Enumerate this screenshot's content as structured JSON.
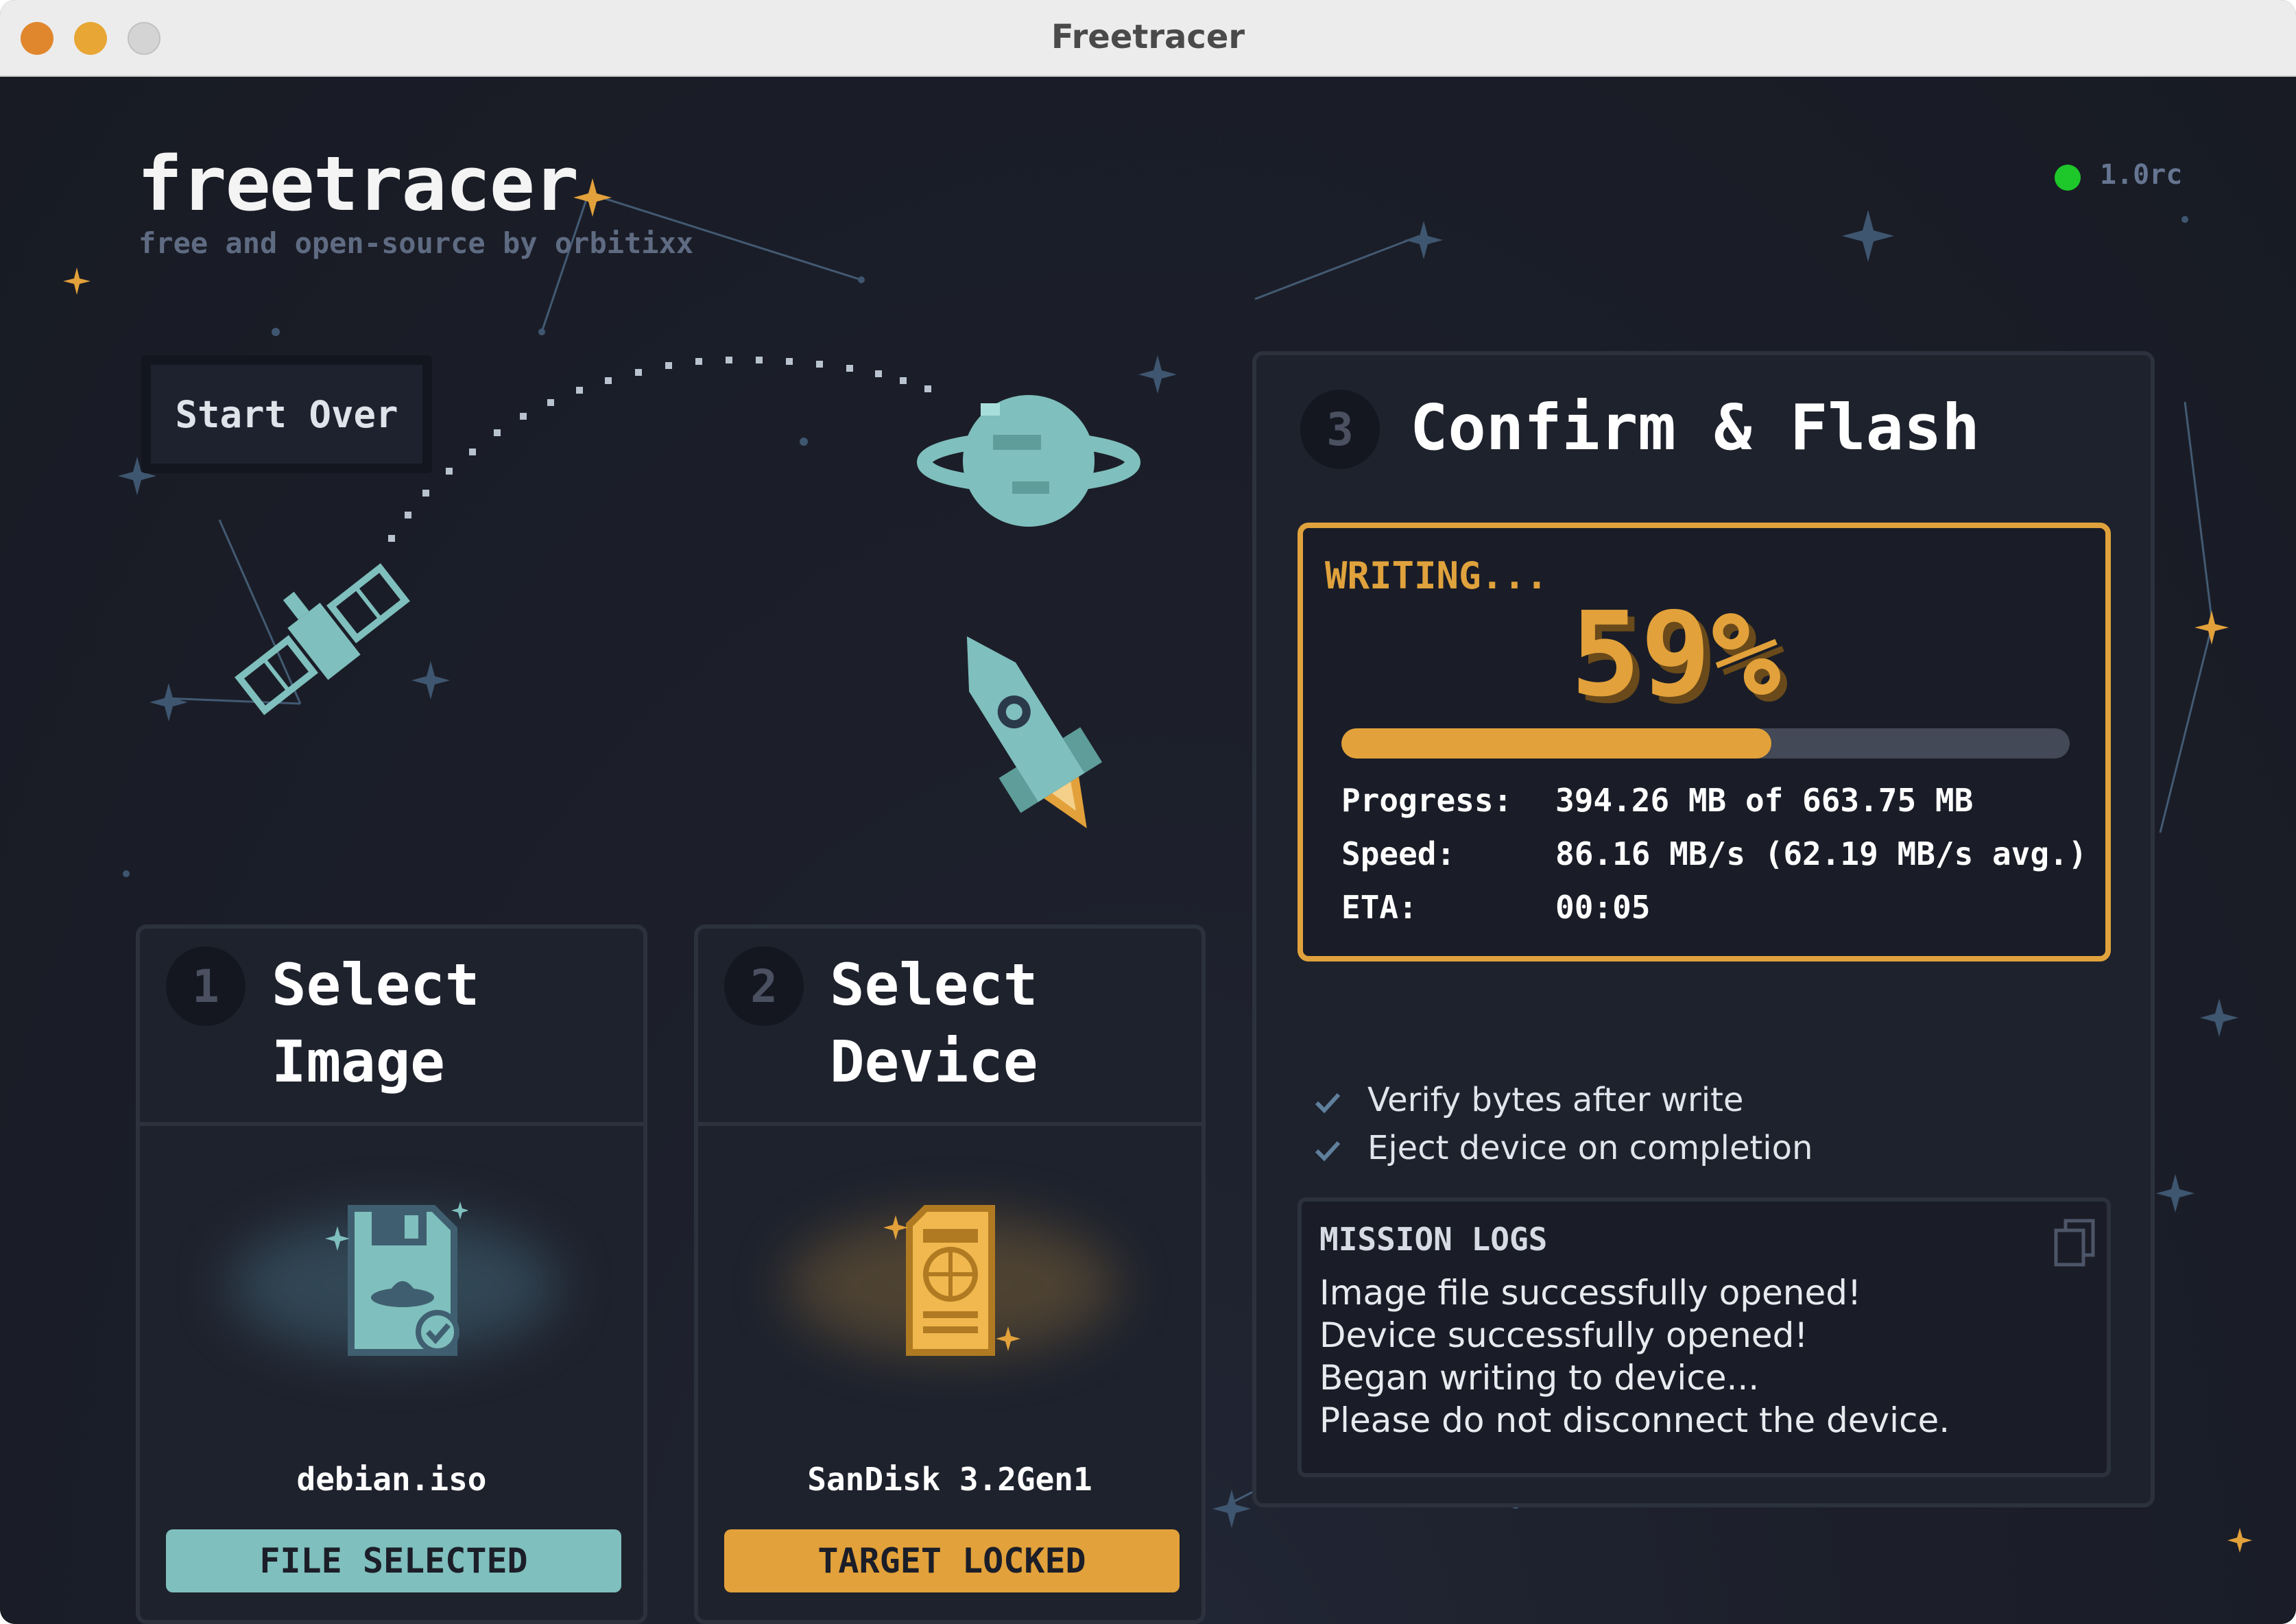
{
  "window": {
    "title": "Freetracer"
  },
  "header": {
    "brand": "freetracer",
    "subtitle": "free and open-source by orbitixx",
    "version": "1.0rc",
    "status_color": "#1ec72a"
  },
  "actions": {
    "start_over_label": "Start Over"
  },
  "steps": [
    {
      "number": "1",
      "title_line1": "Select",
      "title_line2": "Image",
      "caption": "debian.iso",
      "button_label": "FILE SELECTED",
      "button_color": "#7fbfbd",
      "icon": "floppy-disk-icon"
    },
    {
      "number": "2",
      "title_line1": "Select",
      "title_line2": "Device",
      "caption": "SanDisk 3.2Gen1",
      "button_label": "TARGET LOCKED",
      "button_color": "#e2a13a",
      "icon": "sd-card-icon"
    }
  ],
  "flash": {
    "number": "3",
    "title": "Confirm & Flash",
    "status": "WRITING...",
    "percent_text": "59%",
    "progress_fraction": 0.59,
    "accent_color": "#e2a13a",
    "stats": [
      {
        "key": "Progress:",
        "value": "394.26 MB of 663.75 MB"
      },
      {
        "key": "Speed:",
        "value": "86.16 MB/s (62.19 MB/s avg.)"
      },
      {
        "key": "ETA:",
        "value": "00:05"
      }
    ],
    "options": [
      {
        "label": "Verify bytes after write",
        "checked": true
      },
      {
        "label": "Eject device on completion",
        "checked": true
      }
    ],
    "logs_title": "MISSION LOGS",
    "logs": [
      "Image file successfully opened!",
      "Device successfully opened!",
      "Began writing to device...",
      "Please do not disconnect the device."
    ]
  }
}
